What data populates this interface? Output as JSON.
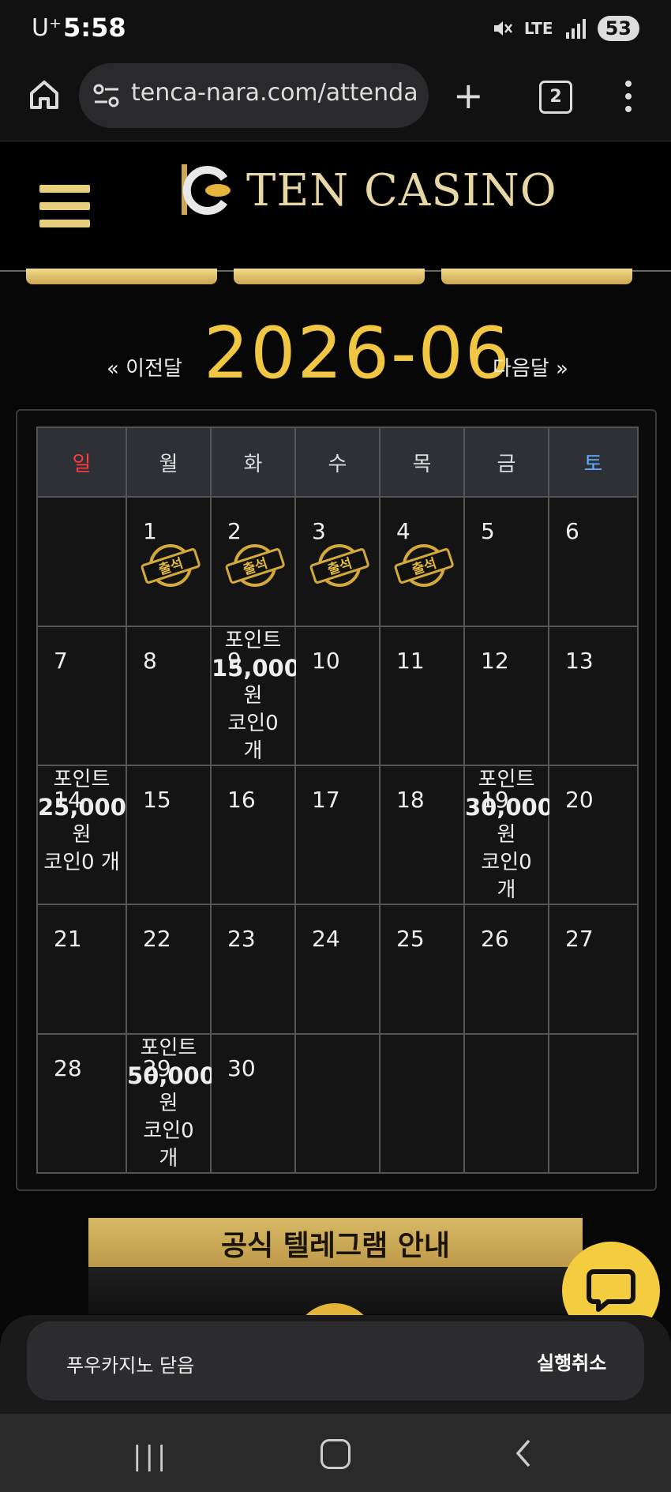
{
  "status": {
    "carrier": "U⁺",
    "time": "5:58",
    "network": "LTE",
    "battery": "53"
  },
  "browser": {
    "url": "tenca-nara.com/attendanc",
    "tab_count": "2"
  },
  "site": {
    "logo_text": "TEN CASINO"
  },
  "calendar": {
    "prev_label": "« 이전달",
    "title": "2026-06",
    "next_label": "다음달 »",
    "weekdays": [
      "일",
      "월",
      "화",
      "수",
      "목",
      "금",
      "토"
    ],
    "weekday_colors": [
      "#ff3b3b",
      "#dddddd",
      "#dddddd",
      "#dddddd",
      "#dddddd",
      "#dddddd",
      "#66aaff"
    ],
    "stamp_label": "출석",
    "weeks": [
      [
        {
          "d": ""
        },
        {
          "d": "1",
          "stamp": true
        },
        {
          "d": "2",
          "stamp": true
        },
        {
          "d": "3",
          "stamp": true
        },
        {
          "d": "4",
          "stamp": true
        },
        {
          "d": "5"
        },
        {
          "d": "6"
        }
      ],
      [
        {
          "d": "7"
        },
        {
          "d": "8"
        },
        {
          "d": "9",
          "reward": {
            "label": "포인트",
            "amount": "15,000",
            "unit": "원",
            "coin": "코인0",
            "coin_unit": "개"
          }
        },
        {
          "d": "10"
        },
        {
          "d": "11"
        },
        {
          "d": "12"
        },
        {
          "d": "13"
        }
      ],
      [
        {
          "d": "14",
          "reward": {
            "label": "포인트",
            "amount": "25,000",
            "unit": "원",
            "coin": "코인0 개",
            "coin_unit": ""
          }
        },
        {
          "d": "15"
        },
        {
          "d": "16"
        },
        {
          "d": "17"
        },
        {
          "d": "18"
        },
        {
          "d": "19",
          "reward": {
            "label": "포인트",
            "amount": "30,000",
            "unit": "원",
            "coin": "코인0",
            "coin_unit": "개"
          }
        },
        {
          "d": "20"
        }
      ],
      [
        {
          "d": "21"
        },
        {
          "d": "22"
        },
        {
          "d": "23"
        },
        {
          "d": "24"
        },
        {
          "d": "25"
        },
        {
          "d": "26"
        },
        {
          "d": "27"
        }
      ],
      [
        {
          "d": "28"
        },
        {
          "d": "29",
          "reward": {
            "label": "포인트",
            "amount": "50,000",
            "unit": "원",
            "coin": "코인0",
            "coin_unit": "개"
          }
        },
        {
          "d": "30"
        },
        {
          "d": ""
        },
        {
          "d": ""
        },
        {
          "d": ""
        },
        {
          "d": ""
        }
      ]
    ]
  },
  "banner": {
    "title": "공식 텔레그램 안내"
  },
  "snackbar": {
    "message": "푸우카지노 닫음",
    "action": "실행취소"
  }
}
